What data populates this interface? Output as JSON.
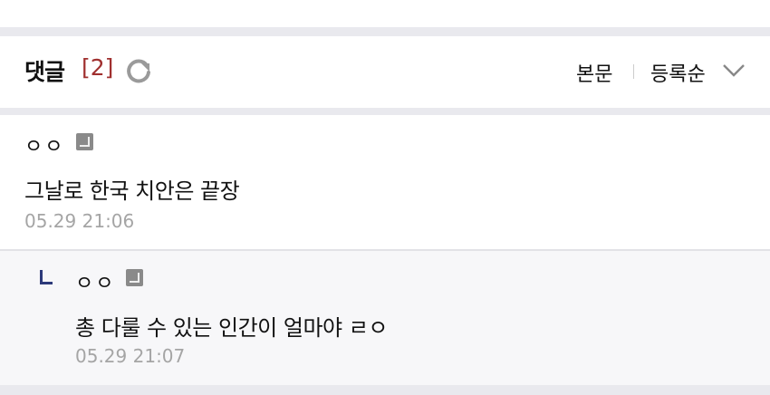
{
  "header": {
    "title": "댓글",
    "count": "[2]",
    "sort_body": "본문",
    "sort_order": "등록순"
  },
  "comments": [
    {
      "nick": "ㅇㅇ",
      "text": "그날로 한국 치안은 끝장",
      "time": "05.29 21:06"
    }
  ],
  "replies": [
    {
      "nick": "ㅇㅇ",
      "text": "총 다룰 수 있는 인간이 얼마야 ㄹㅇ",
      "time": "05.29 21:07"
    }
  ]
}
